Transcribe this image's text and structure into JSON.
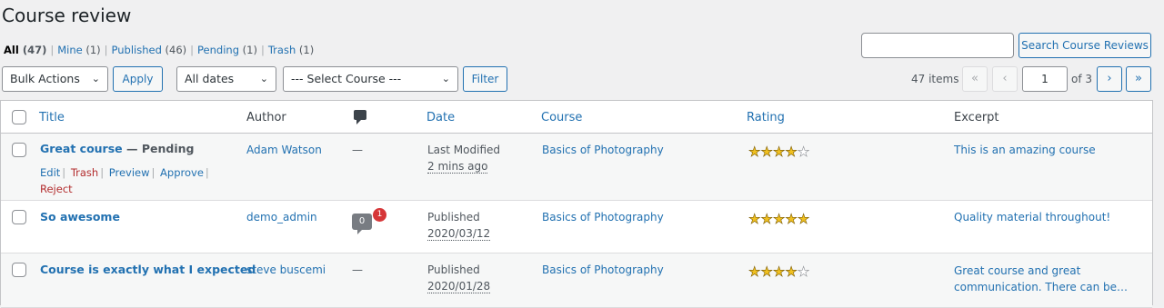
{
  "page": {
    "title": "Course review"
  },
  "filters": [
    {
      "label": "All",
      "count": "(47)"
    },
    {
      "label": "Mine",
      "count": "(1)"
    },
    {
      "label": "Published",
      "count": "(46)"
    },
    {
      "label": "Pending",
      "count": "(1)"
    },
    {
      "label": "Trash",
      "count": "(1)"
    }
  ],
  "search": {
    "button_label": "Search Course Reviews",
    "value": ""
  },
  "toolbar": {
    "bulk_label": "Bulk Actions",
    "apply_label": "Apply",
    "dates_label": "All dates",
    "course_label": "--- Select Course ---",
    "filter_label": "Filter"
  },
  "pagination": {
    "items": "47 items",
    "first": "«",
    "prev": "‹",
    "next": "›",
    "last": "»",
    "current": "1",
    "of": "of 3"
  },
  "columns": {
    "title": "Title",
    "author": "Author",
    "date": "Date",
    "course": "Course",
    "rating": "Rating",
    "excerpt": "Excerpt"
  },
  "rows": [
    {
      "title": "Great course",
      "state": " — Pending",
      "actions": {
        "edit": "Edit",
        "trash": "Trash",
        "preview": "Preview",
        "approve": "Approve",
        "reject": "Reject"
      },
      "author": "Adam Watson",
      "comments": "—",
      "date_status": "Last Modified",
      "date_value": "2 mins ago",
      "course": "Basics of Photography",
      "rating": 4,
      "excerpt": "This is an amazing course"
    },
    {
      "title": "So awesome",
      "author": "demo_admin",
      "comments_count": "0",
      "comments_pending": "1",
      "date_status": "Published",
      "date_value": "2020/03/12",
      "course": "Basics of Photography",
      "rating": 5,
      "excerpt": "Quality material throughout!"
    },
    {
      "title": "Course is exactly what I expected",
      "author": "steve buscemi",
      "comments": "—",
      "date_status": "Published",
      "date_value": "2020/01/28",
      "course": "Basics of Photography",
      "rating": 4,
      "excerpt_line1": "Great course and great",
      "excerpt_line2": "communication. There can be…"
    }
  ],
  "colors": {
    "link": "#2271b1",
    "trash": "#b32d2e",
    "badge": "#d63638",
    "star": "#f0c020"
  }
}
